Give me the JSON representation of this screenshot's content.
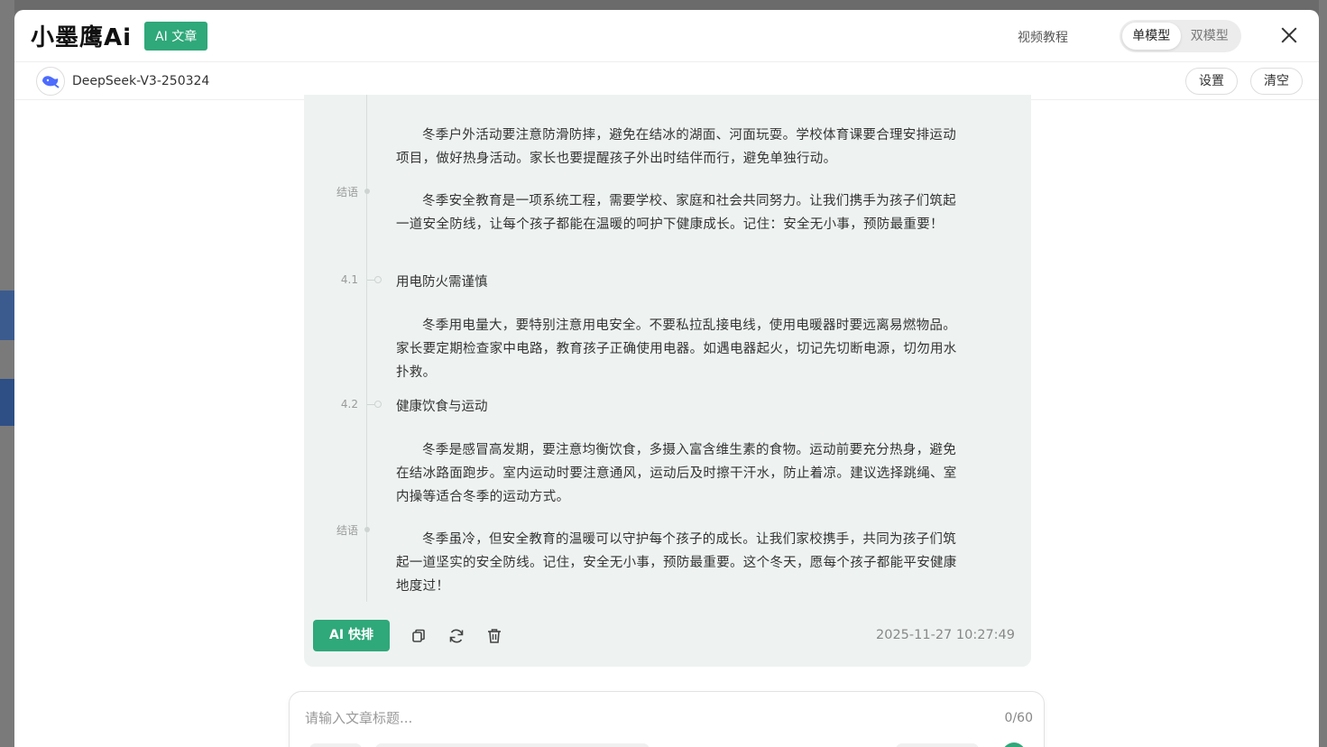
{
  "header": {
    "logo": "小墨鹰Ai",
    "badge": "AI 文章",
    "video_tutorial": "视频教程",
    "modes": [
      {
        "label": "单模型",
        "active": true
      },
      {
        "label": "双模型",
        "active": false
      }
    ],
    "close_icon": "close-icon"
  },
  "subbar": {
    "model_name": "DeepSeek-V3-250324",
    "settings_label": "设置",
    "clear_label": "清空"
  },
  "article": {
    "paragraph_1": "冬季户外活动要注意防滑防摔，避免在结冰的湖面、河面玩耍。学校体育课要合理安排运动项目，做好热身活动。家长也要提醒孩子外出时结伴而行，避免单独行动。",
    "conclusion_label_1": "结语",
    "paragraph_2": "冬季安全教育是一项系统工程，需要学校、家庭和社会共同努力。让我们携手为孩子们筑起一道安全防线，让每个孩子都能在温暖的呵护下健康成长。记住：安全无小事，预防最重要！",
    "section_41_num": "4.1",
    "section_41_title": "用电防火需谨慎",
    "paragraph_3": "冬季用电量大，要特别注意用电安全。不要私拉乱接电线，使用电暖器时要远离易燃物品。家长要定期检查家中电路，教育孩子正确使用电器。如遇电器起火，切记先切断电源，切勿用水扑救。",
    "section_42_num": "4.2",
    "section_42_title": "健康饮食与运动",
    "paragraph_4": "冬季是感冒高发期，要注意均衡饮食，多摄入富含维生素的食物。运动前要充分热身，避免在结冰路面跑步。室内运动时要注意通风，运动后及时擦干汗水，防止着凉。建议选择跳绳、室内操等适合冬季的运动方式。",
    "conclusion_label_2": "结语",
    "paragraph_5": "冬季虽冷，但安全教育的温暖可以守护每个孩子的成长。让我们家校携手，共同为孩子们筑起一道坚实的安全防线。记住，安全无小事，预防最重要。这个冬天，愿每个孩子都能平安健康地度过！"
  },
  "actions": {
    "ai_layout_label": "AI 快排",
    "icons": [
      "copy-icon",
      "refresh-icon",
      "delete-icon"
    ],
    "timestamp": "2025-11-27 10:27:49"
  },
  "input": {
    "placeholder": "请输入文章标题...",
    "value": "",
    "char_count": "0/60"
  },
  "colors": {
    "accent": "#2fa87a",
    "card_bg": "#eef3f1"
  }
}
